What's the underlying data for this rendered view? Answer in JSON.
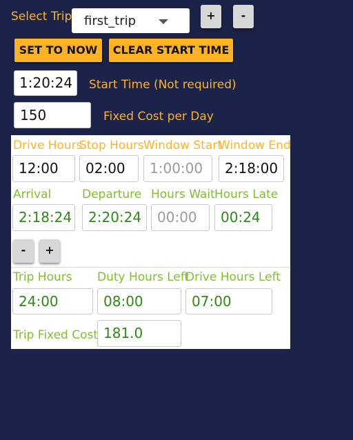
{
  "header": {
    "select_trip_label": "Select Trip",
    "trip_value": "first_trip",
    "plus_label": "+",
    "minus_label": "-"
  },
  "actions": {
    "set_to_now": "SET TO NOW",
    "clear_start_time": "CLEAR START TIME"
  },
  "start_time": {
    "value": "1:20:24",
    "label": "Start Time (Not required)"
  },
  "fixed_cost": {
    "value": "150",
    "label": "Fixed Cost per Day"
  },
  "panel": {
    "headers1": {
      "drive_hours": "Drive Hours",
      "stop_hours": "Stop Hours",
      "window_start": "Window Start",
      "window_end": "Window End"
    },
    "row1": {
      "drive_hours": "12:00",
      "stop_hours": "02:00",
      "window_start": "1:00:00",
      "window_end": "2:18:00"
    },
    "headers2": {
      "arrival": "Arrival",
      "departure": "Departure",
      "hours_wait": "Hours Wait",
      "hours_late": "Hours Late"
    },
    "row2": {
      "arrival": "2:18:24",
      "departure": "2:20:24",
      "hours_wait": "00:00",
      "hours_late": "00:24"
    },
    "minus_label": "-",
    "plus_label": "+",
    "headers3": {
      "trip_hours": "Trip Hours",
      "duty_hours_left": "Duty Hours Left",
      "drive_hours_left": "Drive Hours Left"
    },
    "row3": {
      "trip_hours": "24:00",
      "duty_hours_left": "08:00",
      "drive_hours_left": "07:00"
    },
    "trip_fixed_cost_label": "Trip Fixed Cost",
    "trip_fixed_cost_value": "181.0"
  },
  "colors": {
    "background": "#1b2348",
    "accent_orange": "#ffb322",
    "label_green": "#7fbf2e",
    "value_green": "#2b8a12"
  }
}
